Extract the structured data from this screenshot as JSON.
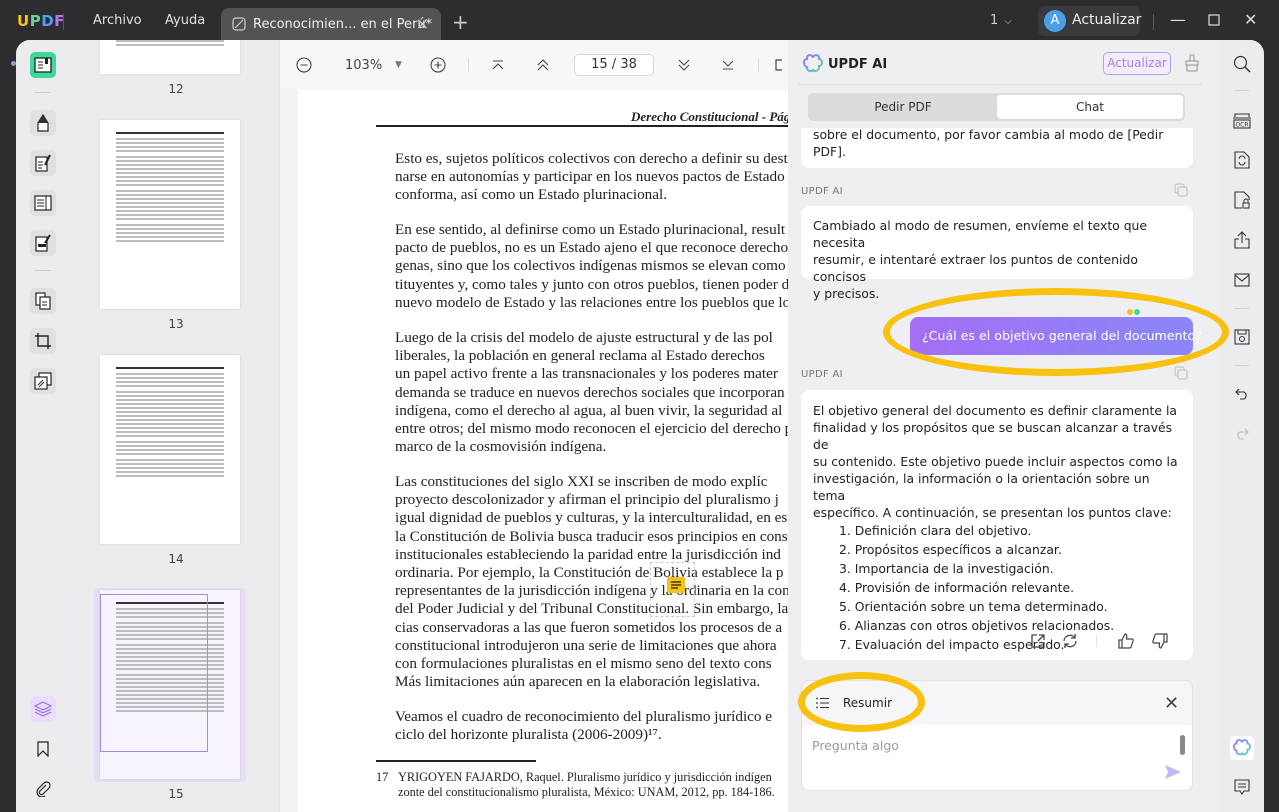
{
  "app": {
    "logo": "UPDF",
    "menu": [
      "Archivo",
      "Ayuda"
    ],
    "tab_title": "Reconocimien... en el Perú*",
    "window_count": "1",
    "upgrade_label": "Actualizar",
    "avatar_initial": "A"
  },
  "left_toolbar": {
    "tools": [
      "reader",
      "comment",
      "edit-pdf",
      "form",
      "redact",
      "organize-pages",
      "crop",
      "batch"
    ],
    "bottom_tools": [
      "layers",
      "bookmark",
      "attachment"
    ]
  },
  "thumbnails": {
    "pages": [
      "12",
      "13",
      "14",
      "15"
    ],
    "selected": "15"
  },
  "viewer_toolbar": {
    "zoom": "103%",
    "current_page": "15",
    "total_pages": "38",
    "page_separator": "/"
  },
  "document": {
    "running_head": "Derecho Constitucional - Pág",
    "paragraphs": [
      [
        "Esto es, sujetos políticos colectivos con derecho a definir su desti",
        "narse en autonomías y participar en los nuevos pactos de Estado",
        "conforma, así como un Estado plurinacional."
      ],
      [
        "En ese sentido, al definirse como un Estado plurinacional, result",
        "pacto de pueblos, no es un Estado ajeno el que reconoce derechos",
        "genas, sino que los colectivos indígenas mismos se elevan como su",
        "tituyentes y, como tales y junto con otros pueblos, tienen poder d",
        "nuevo modelo de Estado y las relaciones entre los pueblos que lo c"
      ],
      [
        "Luego de la crisis del modelo de ajuste estructural y de las pol",
        "liberales, la población en general reclama al Estado derechos",
        "un papel activo frente a las transnacionales y los poderes mater",
        "demanda se traduce en nuevos derechos sociales que incorporan",
        "indígena, como el derecho al agua, al buen vivir, la seguridad al",
        "entre otros; del mismo modo reconocen el ejercicio del derecho p",
        "marco de la cosmovisión indígena."
      ],
      [
        "Las constituciones del siglo XXI se inscriben de modo explíc",
        "proyecto descolonizador y afirman el principio del pluralismo j",
        "igual dignidad de pueblos y culturas, y la interculturalidad, en es",
        "la Constitución de Bolivia busca traducir esos principios en cons",
        "institucionales estableciendo la paridad entre la jurisdicción ind",
        "ordinaria. Por ejemplo, la Constitución de Bolivia establece la p",
        "representantes de la jurisdicción indígena y la ordinaria en la con",
        "del Poder Judicial y del Tribunal Constitucional. Sin embargo, la",
        "cias conservadoras a las que fueron sometidos los procesos de a",
        "constitucional introdujeron una serie de limitaciones que ahora",
        "con formulaciones pluralistas en el mismo seno del texto cons",
        "Más limitaciones aún aparecen en la elaboración legislativa."
      ],
      [
        "Veamos el cuadro de reconocimiento del pluralismo jurídico e",
        "ciclo del horizonte pluralista (2006-2009)¹⁷."
      ]
    ],
    "footnote": {
      "number": "17",
      "lines": [
        "YRIGOYEN FAJARDO, Raquel. Pluralismo jurídico y jurisdicción indígen",
        "zonte del constitucionalismo pluralista, México: UNAM, 2012, pp. 184-186."
      ]
    }
  },
  "ai_panel": {
    "title": "UPDF AI",
    "upgrade_label": "Actualizar",
    "modes": [
      "Pedir PDF",
      "Chat"
    ],
    "active_mode": "Chat",
    "messages": [
      {
        "role": "ai",
        "lines": [
          "sobre el documento, por favor cambia al modo de [Pedir",
          "PDF]."
        ]
      },
      {
        "role": "ai",
        "sender": "UPDF AI",
        "lines": [
          "Cambiado al modo de resumen, envíeme el texto que necesita",
          "resumir, e intentaré extraer los puntos de contenido concisos",
          "y precisos."
        ]
      },
      {
        "role": "user",
        "text": "¿Cuál es el objetivo general del documento?"
      },
      {
        "role": "ai",
        "sender": "UPDF AI",
        "lines": [
          "El objetivo general del documento es definir claramente la",
          "finalidad y los propósitos que se buscan alcanzar a través de",
          "su contenido. Este objetivo puede incluir aspectos como la",
          "investigación, la información o la orientación sobre un tema",
          "específico. A continuación, se presentan los puntos clave:"
        ],
        "list": [
          "1. Definición clara del objetivo.",
          "2. Propósitos específicos a alcanzar.",
          "3. Importancia de la investigación.",
          "4. Provisión de información relevante.",
          "5. Orientación sobre un tema determinado.",
          "6. Alianzas con otros objetivos relacionados.",
          "7. Evaluación del impacto esperado."
        ]
      }
    ],
    "composer": {
      "mode_label": "Resumir",
      "placeholder": "Pregunta algo",
      "value": ""
    }
  },
  "right_toolbar": {
    "tools": [
      "search",
      "ocr",
      "convert",
      "protect",
      "share",
      "email",
      "save",
      "undo",
      "redo"
    ],
    "bottom_tools": [
      "updf-ai",
      "comments"
    ]
  },
  "colors": {
    "accent_green": "#3ed99a",
    "ai_purple": "#a46ef5",
    "highlight_yellow": "#f8c00f",
    "titlebar": "#2d2d2f"
  }
}
